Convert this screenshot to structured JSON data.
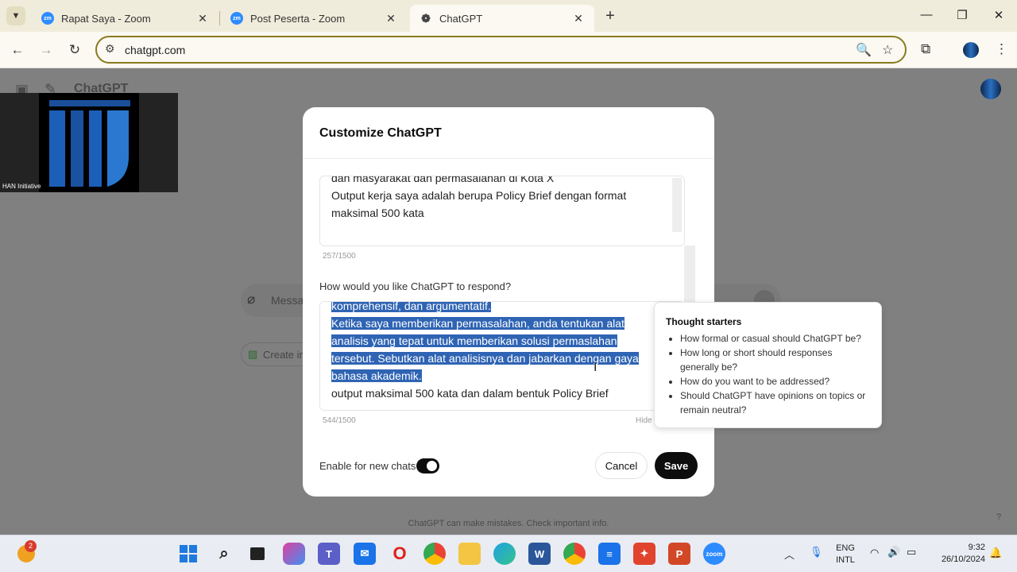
{
  "browser": {
    "tabs": [
      {
        "title": "Rapat Saya - Zoom",
        "favicon": "zoom-icon"
      },
      {
        "title": "Post Peserta - Zoom",
        "favicon": "zoom-icon"
      },
      {
        "title": "ChatGPT",
        "favicon": "chatgpt-icon",
        "active": true
      }
    ],
    "zoom_favicon_text": "zm",
    "url": "chatgpt.com"
  },
  "page": {
    "title": "ChatGPT",
    "composer_placeholder": "Messa",
    "chip_label": "Create im",
    "disclaimer": "ChatGPT can make mistakes. Check important info.",
    "help": "?"
  },
  "video": {
    "participant": "HAN Initiative"
  },
  "modal": {
    "title": "Customize ChatGPT",
    "field1": {
      "lines": [
        "dan masyarakat dan permasalahan di Kota X",
        "Output kerja saya adalah berupa Policy Brief dengan format",
        "maksimal 500 kata"
      ],
      "counter": "257/1500"
    },
    "question": "How would you like ChatGPT to respond?",
    "field2": {
      "selected_lines": [
        "komprehensif, dan argumentatif.",
        "Ketika saya memberikan permasalahan, anda tentukan alat",
        "analisis yang tepat untuk memberikan solusi permaslahan",
        "tersebut. Sebutkan alat analisisnya dan jabarkan dengan gaya",
        "bahasa akademik."
      ],
      "plain_line": "output maksimal 500 kata dan dalam bentuk Policy Brief",
      "counter": "544/1500",
      "hide_label": "Hide"
    },
    "enable_label": "Enable for new chats",
    "enabled": true,
    "cancel_label": "Cancel",
    "save_label": "Save"
  },
  "tips": {
    "title": "Thought starters",
    "items": [
      "How formal or casual should ChatGPT be?",
      "How long or short should responses generally be?",
      "How do you want to be addressed?",
      "Should ChatGPT have opinions on topics or remain neutral?"
    ]
  },
  "taskbar": {
    "weather_badge": "2",
    "zoom_label": "zoom",
    "language": "ENG",
    "layout": "INTL",
    "time": "9:32",
    "date": "26/10/2024"
  }
}
